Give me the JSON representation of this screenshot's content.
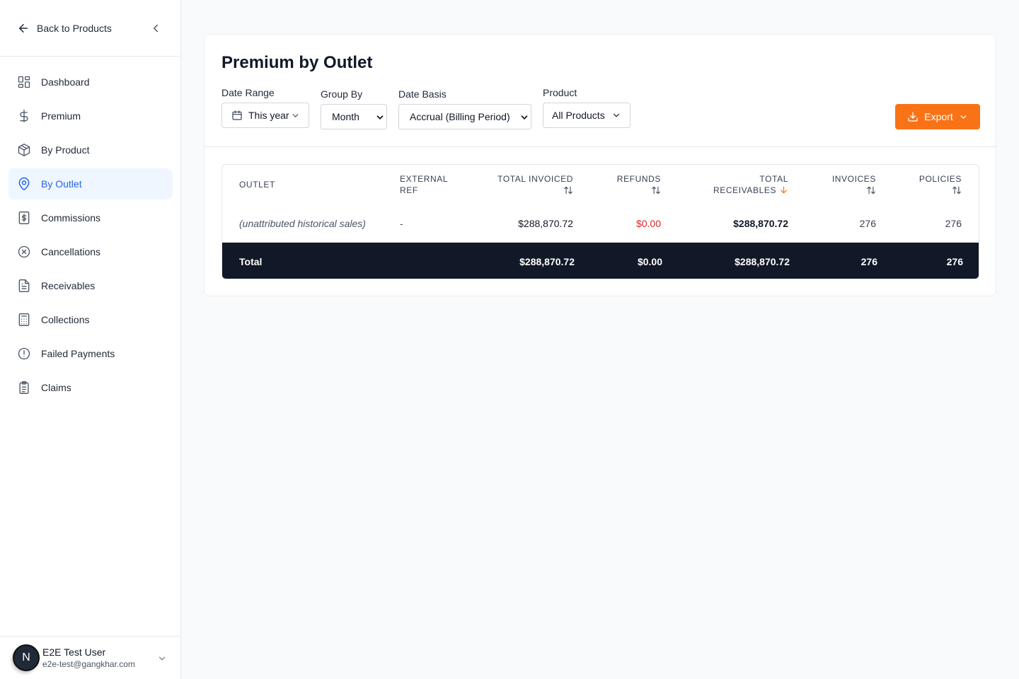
{
  "sidebar": {
    "back_label": "Back to Products",
    "items": [
      {
        "label": "Dashboard",
        "icon": "dashboard-icon"
      },
      {
        "label": "Premium",
        "icon": "dollar-icon"
      },
      {
        "label": "By Product",
        "icon": "package-icon"
      },
      {
        "label": "By Outlet",
        "icon": "map-pin-icon",
        "active": true
      },
      {
        "label": "Commissions",
        "icon": "receipt-dollar-icon"
      },
      {
        "label": "Cancellations",
        "icon": "x-circle-icon"
      },
      {
        "label": "Receivables",
        "icon": "file-text-icon"
      },
      {
        "label": "Collections",
        "icon": "calculator-icon"
      },
      {
        "label": "Failed Payments",
        "icon": "alert-circle-icon"
      },
      {
        "label": "Claims",
        "icon": "clipboard-icon"
      }
    ],
    "user": {
      "initial": "N",
      "name": "E2E Test User",
      "email": "e2e-test@gangkhar.com"
    }
  },
  "page": {
    "title": "Premium by Outlet",
    "filters": {
      "date_range": {
        "label": "Date Range",
        "value": "This year"
      },
      "group_by": {
        "label": "Group By",
        "value": "Month"
      },
      "date_basis": {
        "label": "Date Basis",
        "value": "Accrual (Billing Period)"
      },
      "product": {
        "label": "Product",
        "value": "All Products"
      }
    },
    "export_label": "Export"
  },
  "table": {
    "headers": {
      "outlet": "OUTLET",
      "external_ref_1": "EXTERNAL",
      "external_ref_2": "REF",
      "total_invoiced": "TOTAL INVOICED",
      "refunds": "REFUNDS",
      "total_receivables_1": "TOTAL",
      "total_receivables_2": "RECEIVABLES",
      "invoices": "INVOICES",
      "policies": "POLICIES"
    },
    "rows": [
      {
        "outlet": "(unattributed historical sales)",
        "external_ref": "-",
        "total_invoiced": "$288,870.72",
        "refunds": "$0.00",
        "total_receivables": "$288,870.72",
        "invoices": "276",
        "policies": "276"
      }
    ],
    "total": {
      "label": "Total",
      "total_invoiced": "$288,870.72",
      "refunds": "$0.00",
      "total_receivables": "$288,870.72",
      "invoices": "276",
      "policies": "276"
    }
  },
  "colors": {
    "accent": "#f97316",
    "active_nav": "#2563eb",
    "refund_red": "#dc2626",
    "total_bg": "#111827"
  }
}
